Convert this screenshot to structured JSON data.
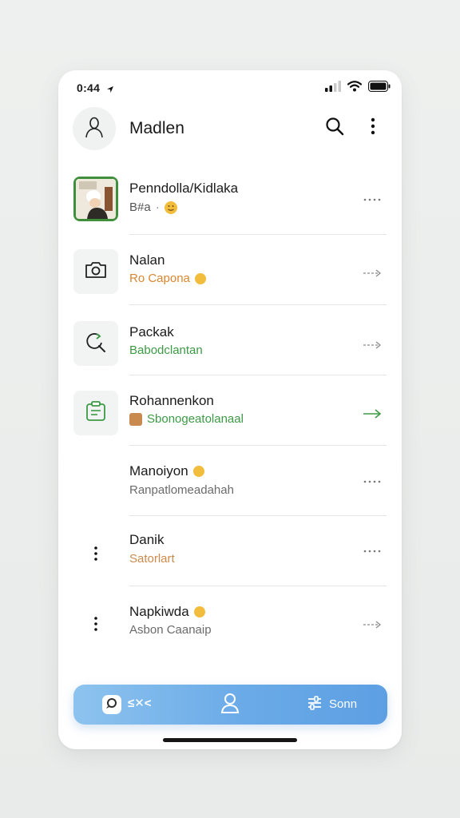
{
  "status_bar": {
    "time": "0:44"
  },
  "header": {
    "title": "Madlen"
  },
  "items": [
    {
      "name": "Penndolla/Kidlaka",
      "sub": "B#a",
      "sub_color": "#555555",
      "thumb": "photo-avatar",
      "trail": "dots"
    },
    {
      "name": "Nalan",
      "sub": "Ro Capona",
      "sub_color": "#d9862e",
      "thumb": "camera-icon",
      "trail": "arrow"
    },
    {
      "name": "Packak",
      "sub": "Babodclantan",
      "sub_color": "#3d9a45",
      "thumb": "refresh-search-icon",
      "trail": "arrow"
    },
    {
      "name": "Rohannenkon",
      "sub": "Sbonogeatolanaal",
      "sub_color": "#3d9a45",
      "thumb": "clipboard-icon",
      "trail": "arrow-accent"
    },
    {
      "name": "Manoiyon",
      "sub": "Ranpatlomeadahah",
      "sub_color": "#6b6b6b",
      "thumb": "none",
      "trail": "dots"
    },
    {
      "name": "Danik",
      "sub": "Satorlart",
      "sub_color": "#cc8a4c",
      "thumb": "kebab",
      "trail": "dots"
    },
    {
      "name": "Napkiwda",
      "sub": "Asbon Caanaip",
      "sub_color": "#6b6b6b",
      "thumb": "kebab",
      "trail": "arrow"
    }
  ],
  "bottom_nav": {
    "left_label": "≤✕<",
    "right_label": "Sonn"
  },
  "colors": {
    "accent_green": "#3d9a45",
    "accent_orange": "#d9862e",
    "nav_blue": "#6aaae8",
    "emoji_yellow": "#f2bd3c"
  }
}
